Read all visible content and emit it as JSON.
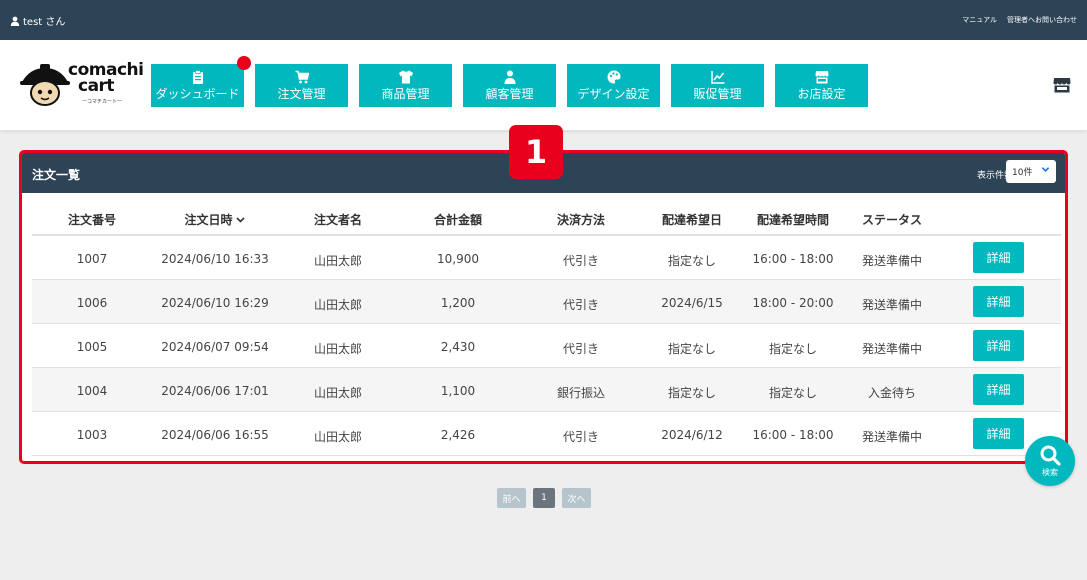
{
  "topbar": {
    "user_label": "test さん",
    "links": [
      "マニュアル",
      "管理者へお問い合わせ"
    ]
  },
  "logo": {
    "word1": "comachi",
    "word2": "cart",
    "tagline": "ーコマチカートー"
  },
  "nav": [
    {
      "label": "ダッシュボード",
      "icon": "clipboard-icon",
      "badge": true
    },
    {
      "label": "注文管理",
      "icon": "cart-icon"
    },
    {
      "label": "商品管理",
      "icon": "tshirt-icon"
    },
    {
      "label": "顧客管理",
      "icon": "user-icon"
    },
    {
      "label": "デザイン設定",
      "icon": "palette-icon"
    },
    {
      "label": "販促管理",
      "icon": "chart-line-icon"
    },
    {
      "label": "お店設定",
      "icon": "store-icon"
    }
  ],
  "callout_number": "1",
  "panel": {
    "title": "注文一覧",
    "per_page_label": "表示件数",
    "per_page_value": "10件"
  },
  "table": {
    "headers": [
      "注文番号",
      "注文日時",
      "注文者名",
      "合計金額",
      "決済方法",
      "配達希望日",
      "配達希望時間",
      "ステータス"
    ],
    "detail_label": "詳細",
    "rows": [
      {
        "id": "1007",
        "date": "2024/06/10 16:33",
        "name": "山田太郎",
        "total": "10,900",
        "payment": "代引き",
        "delivery_date": "指定なし",
        "delivery_time": "16:00 - 18:00",
        "status": "発送準備中"
      },
      {
        "id": "1006",
        "date": "2024/06/10 16:29",
        "name": "山田太郎",
        "total": "1,200",
        "payment": "代引き",
        "delivery_date": "2024/6/15",
        "delivery_time": "18:00 - 20:00",
        "status": "発送準備中"
      },
      {
        "id": "1005",
        "date": "2024/06/07 09:54",
        "name": "山田太郎",
        "total": "2,430",
        "payment": "代引き",
        "delivery_date": "指定なし",
        "delivery_time": "指定なし",
        "status": "発送準備中"
      },
      {
        "id": "1004",
        "date": "2024/06/06 17:01",
        "name": "山田太郎",
        "total": "1,100",
        "payment": "銀行振込",
        "delivery_date": "指定なし",
        "delivery_time": "指定なし",
        "status": "入金待ち"
      },
      {
        "id": "1003",
        "date": "2024/06/06 16:55",
        "name": "山田太郎",
        "total": "2,426",
        "payment": "代引き",
        "delivery_date": "2024/6/12",
        "delivery_time": "16:00 - 18:00",
        "status": "発送準備中"
      }
    ]
  },
  "search_fab": {
    "label": "検索"
  },
  "pagination": {
    "prev": "前へ",
    "current": "1",
    "next": "次へ"
  },
  "colors": {
    "accent": "#00b8be",
    "dark": "#2d4356",
    "alert": "#e8001c"
  }
}
